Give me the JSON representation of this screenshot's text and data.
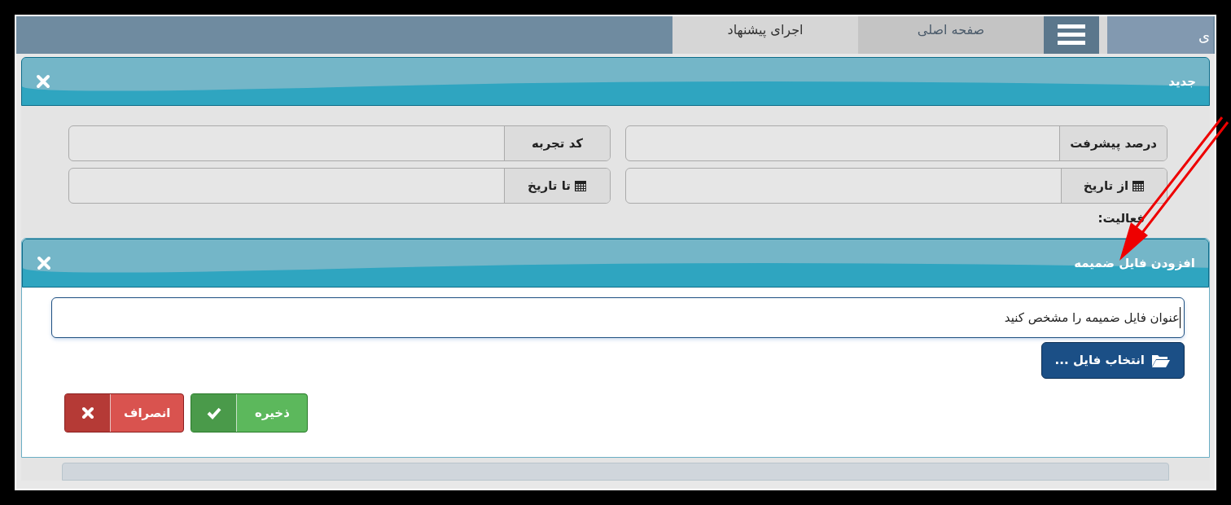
{
  "top_bar": {
    "tabs": [
      {
        "label": "صفحه اصلی",
        "selected": false
      },
      {
        "label": "اجرای پیشنهاد",
        "selected": true
      }
    ],
    "side_text": "ی"
  },
  "form_panel": {
    "title": "جدید",
    "fields": [
      {
        "label": "درصد پیشرفت",
        "kind": "text"
      },
      {
        "label": "کد تجربه",
        "kind": "text"
      },
      {
        "label": "از تاریخ",
        "kind": "date"
      },
      {
        "label": "تا تاریخ",
        "kind": "date"
      }
    ],
    "activity_label": "فعالیت:"
  },
  "dialog": {
    "title": "افزودن فایل ضمیمه",
    "title_field": {
      "value": "عنوان فایل ضمیمه را مشخص کنید"
    },
    "file_button": "انتخاب فایل ...",
    "actions": [
      {
        "label": "ذخیره",
        "kind": "save"
      },
      {
        "label": "انصراف",
        "kind": "cancel"
      }
    ]
  }
}
